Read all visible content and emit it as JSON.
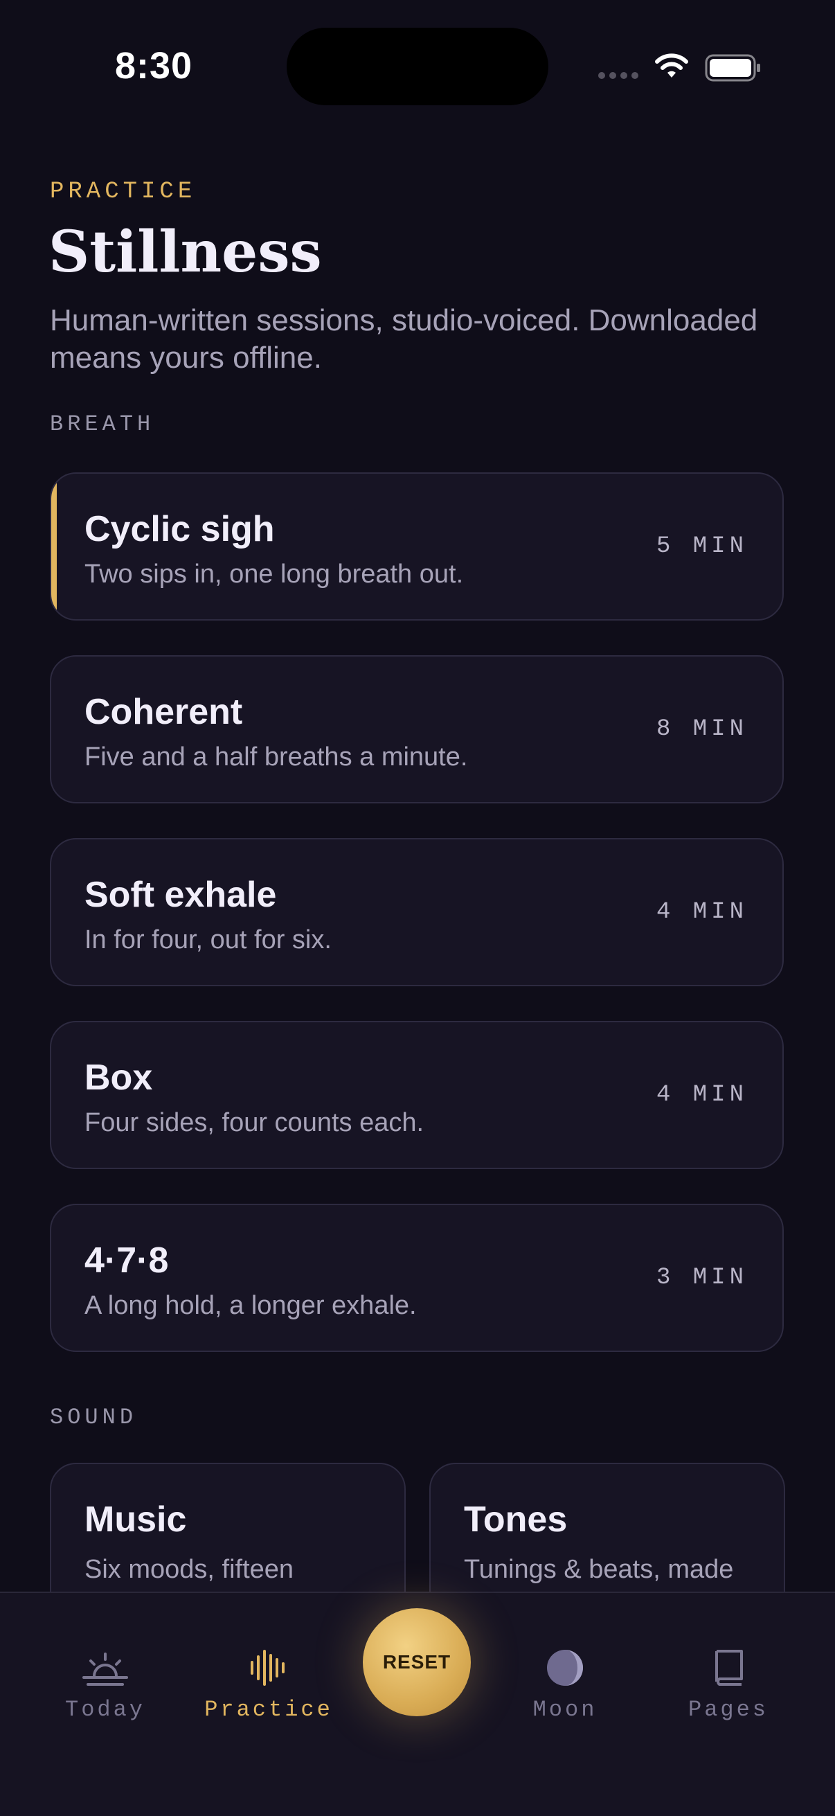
{
  "status_bar": {
    "time": "8:30"
  },
  "header": {
    "eyebrow": "PRACTICE",
    "title": "Stillness",
    "subtitle": "Human-written sessions, studio-voiced. Downloaded means yours offline."
  },
  "breath": {
    "label": "BREATH",
    "sessions": [
      {
        "title": "Cyclic sigh",
        "description": "Two sips in, one long breath out.",
        "duration": "5 MIN",
        "active": true
      },
      {
        "title": "Coherent",
        "description": "Five and a half breaths a minute.",
        "duration": "8 MIN"
      },
      {
        "title": "Soft exhale",
        "description": "In for four, out for six.",
        "duration": "4 MIN"
      },
      {
        "title": "Box",
        "description": "Four sides, four counts each.",
        "duration": "4 MIN"
      },
      {
        "title": "4·7·8",
        "description": "A long hold, a longer exhale.",
        "duration": "3 MIN"
      }
    ]
  },
  "sound": {
    "label": "SOUND",
    "cards": [
      {
        "title": "Music",
        "description": "Six moods, fifteen"
      },
      {
        "title": "Tones",
        "description": "Tunings & beats, made"
      }
    ]
  },
  "tabbar": {
    "today": "Today",
    "practice": "Practice",
    "reset": "RESET",
    "moon": "Moon",
    "pages": "Pages",
    "active_tab": "practice"
  },
  "colors": {
    "background": "#0f0d19",
    "card": "#171424",
    "accent": "#e2b65f",
    "text_primary": "#f1eefa",
    "text_secondary": "#a7a3b8"
  },
  "icons": {
    "today": "sunrise-icon",
    "practice": "waveform-icon",
    "moon": "moon-icon",
    "pages": "book-icon"
  }
}
